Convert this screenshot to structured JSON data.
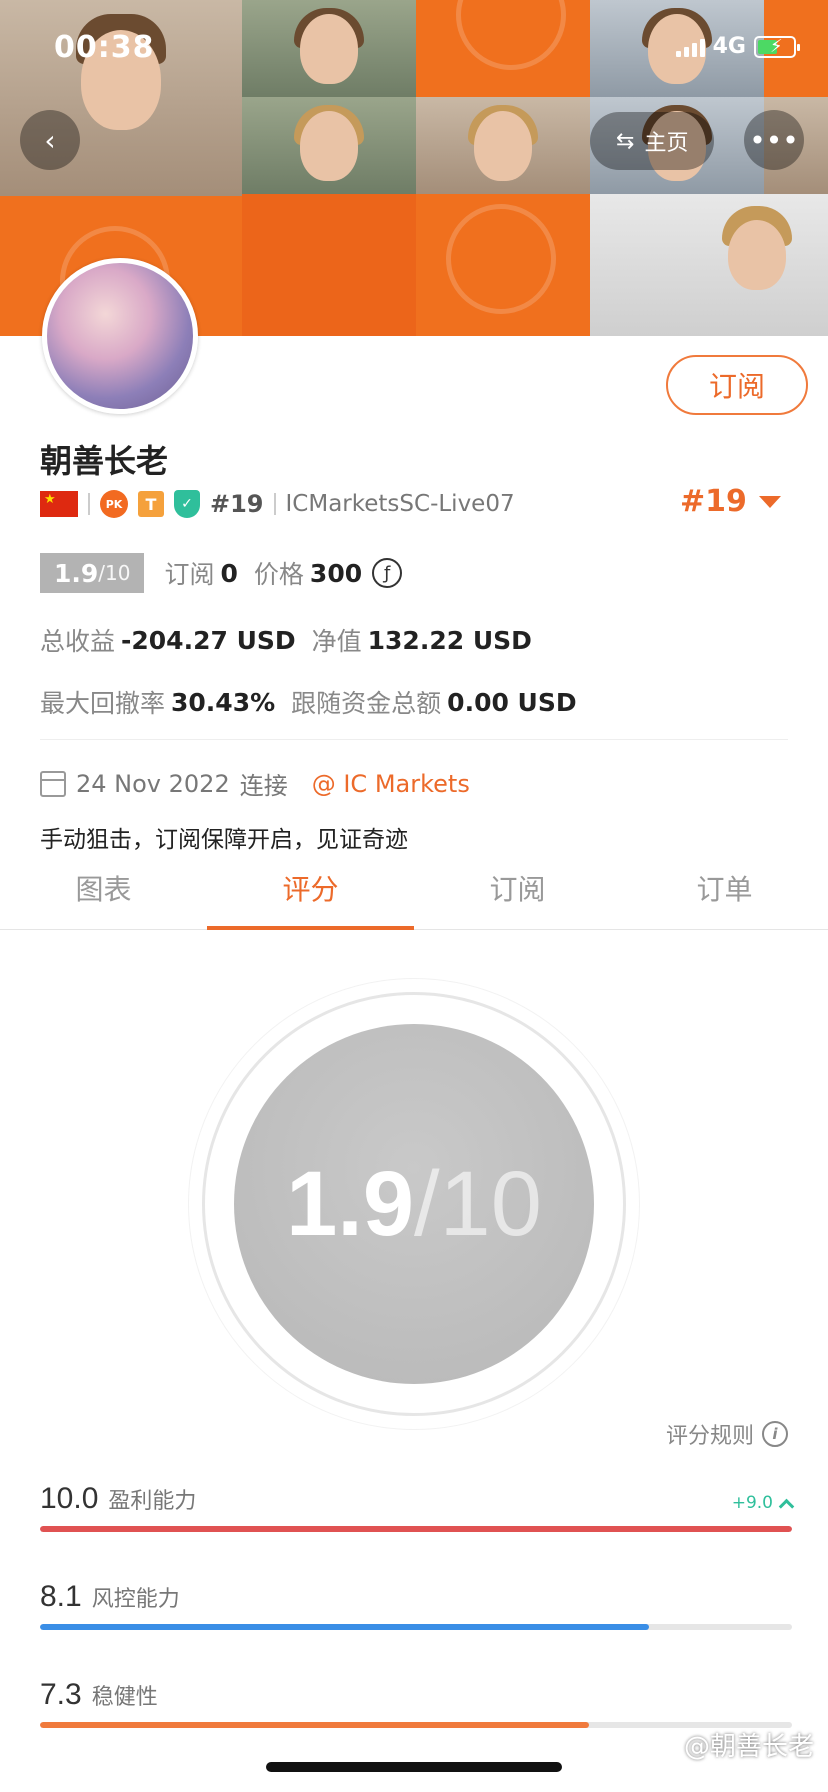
{
  "status_bar": {
    "time": "00:38",
    "network": "4G"
  },
  "header": {
    "home_label": "主页",
    "more_icon": "more-icon",
    "back_icon": "chevron-left-icon",
    "switch_icon": "swap-icon"
  },
  "profile": {
    "name": "朝善长老",
    "subscribe_label": "订阅",
    "badge_pk": "PK",
    "badge_t": "T",
    "rank_small": "#19",
    "server": "ICMarketsSC-Live07",
    "rank_big": "#19"
  },
  "stats": {
    "score": "1.9",
    "score_out": "/10",
    "subs_label": "订阅",
    "subs_value": "0",
    "price_label": "价格",
    "price_value": "300",
    "coin_symbol": "ƒ",
    "total_profit_label": "总收益",
    "total_profit_value": "-204.27 USD",
    "equity_label": "净值",
    "equity_value": "132.22 USD",
    "max_drawdown_label": "最大回撤率",
    "max_drawdown_value": "30.43%",
    "follow_funds_label": "跟随资金总额",
    "follow_funds_value": "0.00 USD"
  },
  "connect": {
    "date": "24 Nov 2022",
    "label": "连接",
    "broker": "@ IC Markets"
  },
  "motto": "手动狙击，订阅保障开启，见证奇迹",
  "tabs": [
    {
      "label": "图表"
    },
    {
      "label": "评分"
    },
    {
      "label": "订阅"
    },
    {
      "label": "订单"
    }
  ],
  "gauge": {
    "score": "1.9",
    "out_of": "/10"
  },
  "rules_label": "评分规则",
  "metrics": [
    {
      "value": "10.0",
      "name": "盈利能力",
      "delta": "+9.0",
      "fraction": 1.0,
      "color": "#e05252"
    },
    {
      "value": "8.1",
      "name": "风控能力",
      "fraction": 0.81,
      "color": "#3a8ee6"
    },
    {
      "value": "7.3",
      "name": "稳健性",
      "fraction": 0.73,
      "color": "#f07a3c"
    }
  ],
  "watermark": "@朝善长老",
  "colors": {
    "accent": "#ec6a2a",
    "banner": "#f06a1a",
    "positive": "#2fbf9b"
  }
}
